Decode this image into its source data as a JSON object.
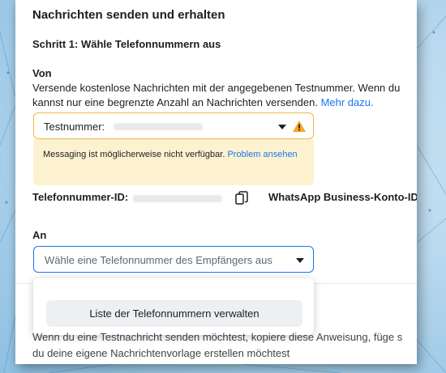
{
  "page": {
    "title": "Nachrichten senden und erhalten",
    "step1": "Schritt 1: Wähle Telefonnummern aus"
  },
  "von": {
    "label": "Von",
    "description_line1": "Versende kostenlose Nachrichten mit der angegebenen Testnummer. Wenn du",
    "description_line2": "kannst nur eine begrenzte Anzahl an Nachrichten versenden.",
    "more_link": "Mehr dazu.",
    "select_label": "Testnummer:",
    "warning_text": "Messaging ist möglicherweise nicht verfügbar.",
    "warning_link": "Problem ansehen"
  },
  "ids": {
    "phone_id_label": "Telefonnummer-ID:",
    "waba_id_label": "WhatsApp Business-Konto-ID:"
  },
  "an": {
    "label": "An",
    "placeholder": "Wähle eine Telefonnummer des Empfängers aus",
    "manage_button": "Liste der Telefonnummern verwalten"
  },
  "footer": {
    "line1": "Wenn du eine Testnachricht senden möchtest, kopiere diese Anweisung, füge s",
    "line2": "du deine eigene Nachrichtenvorlage erstellen möchtest"
  },
  "colors": {
    "link": "#1877f2",
    "warning_border": "#f0b74b",
    "warning_bg": "#fdf2d0",
    "warning_icon": "#f5a623",
    "focus_border": "#1877f2"
  }
}
